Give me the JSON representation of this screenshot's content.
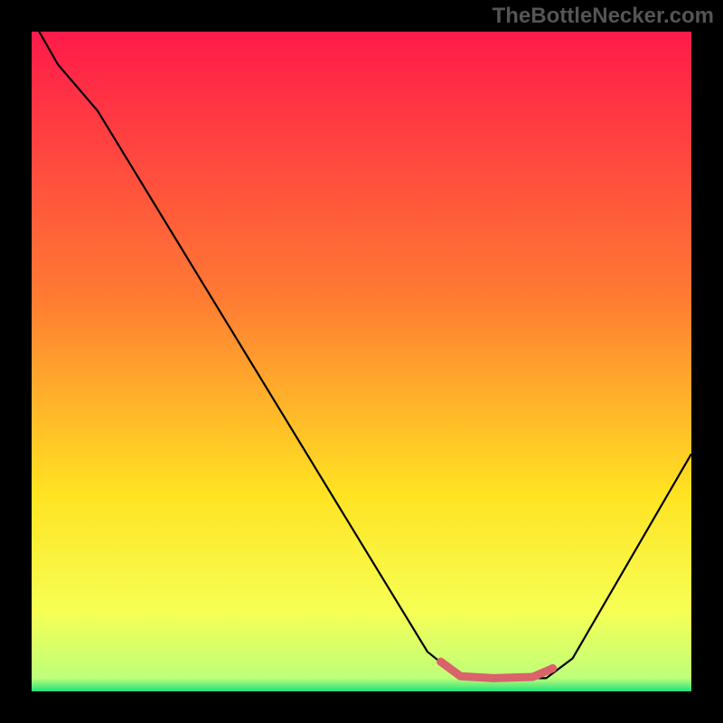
{
  "watermark": "TheBottleNecker.com",
  "chart_data": {
    "type": "line",
    "title": "",
    "xlabel": "",
    "ylabel": "",
    "xlim": [
      0,
      100
    ],
    "ylim": [
      0,
      100
    ],
    "gradient_stops": [
      {
        "offset": 0,
        "color": "#ff1a4a"
      },
      {
        "offset": 40,
        "color": "#ff7a33"
      },
      {
        "offset": 70,
        "color": "#ffe322"
      },
      {
        "offset": 88,
        "color": "#f6ff55"
      },
      {
        "offset": 98,
        "color": "#beff7a"
      },
      {
        "offset": 100,
        "color": "#22e07a"
      }
    ],
    "series": [
      {
        "name": "bottleneck-curve",
        "color": "#000000",
        "width": 2.2,
        "points": [
          {
            "x": 0,
            "y": 102
          },
          {
            "x": 4,
            "y": 95
          },
          {
            "x": 10,
            "y": 88
          },
          {
            "x": 60,
            "y": 6
          },
          {
            "x": 65,
            "y": 2
          },
          {
            "x": 78,
            "y": 2
          },
          {
            "x": 82,
            "y": 5
          },
          {
            "x": 100,
            "y": 36
          }
        ]
      }
    ],
    "highlight_segment": {
      "name": "optimal-range-marker",
      "color": "#d9626b",
      "width": 9,
      "points": [
        {
          "x": 62,
          "y": 4.5
        },
        {
          "x": 65,
          "y": 2.3
        },
        {
          "x": 70,
          "y": 2.0
        },
        {
          "x": 76,
          "y": 2.2
        },
        {
          "x": 79,
          "y": 3.5
        }
      ]
    }
  }
}
